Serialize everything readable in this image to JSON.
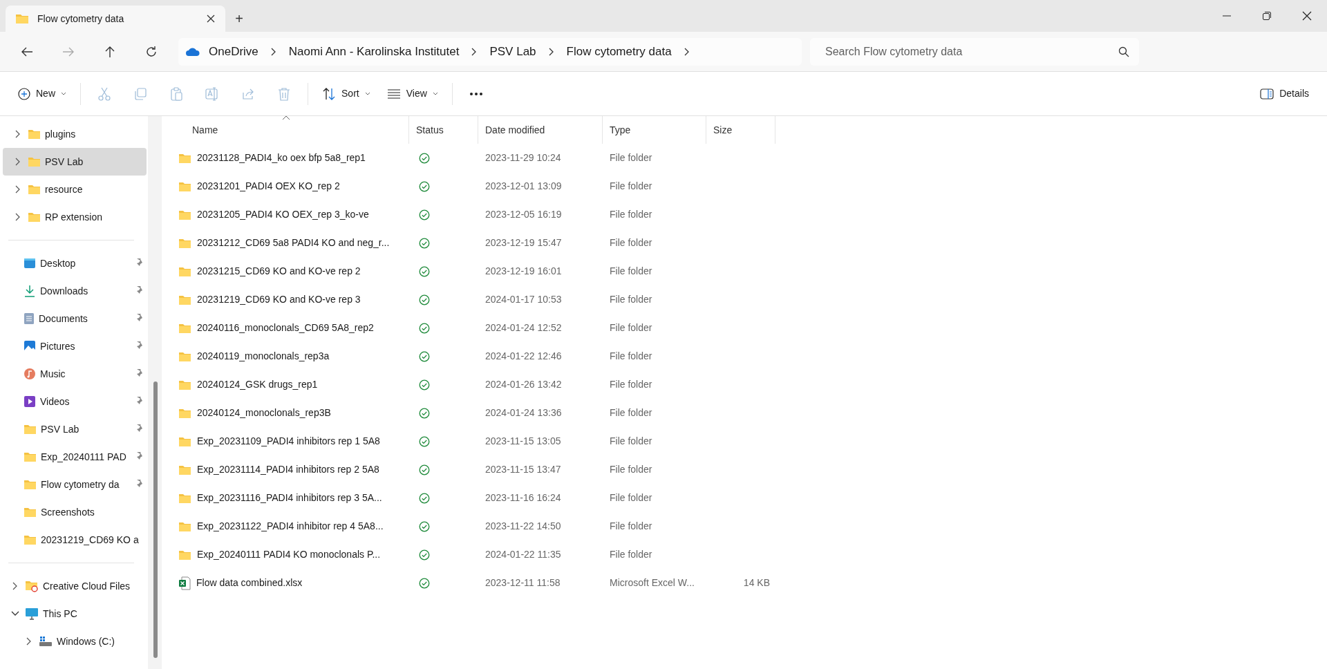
{
  "window": {
    "tab_title": "Flow cytometry data",
    "new_tab": "+"
  },
  "address_bar": {
    "crumbs": [
      "OneDrive",
      "Naomi Ann - Karolinska Institutet",
      "PSV Lab",
      "Flow cytometry data"
    ]
  },
  "search": {
    "placeholder": "Search Flow cytometry data"
  },
  "toolbar": [
    {
      "kind": "new",
      "label": "New",
      "disabled": false
    },
    {
      "kind": "cut",
      "disabled": true
    },
    {
      "kind": "copy",
      "disabled": true
    },
    {
      "kind": "paste",
      "disabled": true
    },
    {
      "kind": "rename",
      "disabled": true
    },
    {
      "kind": "share",
      "disabled": true
    },
    {
      "kind": "delete",
      "disabled": true
    },
    {
      "kind": "sort",
      "label": "Sort",
      "disabled": false
    },
    {
      "kind": "view",
      "label": "View",
      "disabled": false
    },
    {
      "kind": "more",
      "disabled": false
    }
  ],
  "details_button": {
    "label": "Details"
  },
  "sidebar": {
    "tree_top": [
      {
        "label": "plugins",
        "selected": false,
        "expanded": false
      },
      {
        "label": "PSV Lab",
        "selected": true,
        "expanded": false
      },
      {
        "label": "resource",
        "selected": false,
        "expanded": false
      },
      {
        "label": "RP extension",
        "selected": false,
        "expanded": false
      }
    ],
    "quick_access": [
      {
        "kind": "desktop",
        "label": "Desktop",
        "pinned": true
      },
      {
        "kind": "downloads",
        "label": "Downloads",
        "pinned": true
      },
      {
        "kind": "documents",
        "label": "Documents",
        "pinned": true
      },
      {
        "kind": "pictures",
        "label": "Pictures",
        "pinned": true
      },
      {
        "kind": "music",
        "label": "Music",
        "pinned": true
      },
      {
        "kind": "videos",
        "label": "Videos",
        "pinned": true
      },
      {
        "kind": "folder",
        "label": "PSV Lab",
        "pinned": true
      },
      {
        "kind": "folder",
        "label": "Exp_20240111 PAD",
        "pinned": true
      },
      {
        "kind": "folder",
        "label": "Flow cytometry da",
        "pinned": true
      },
      {
        "kind": "folder",
        "label": "Screenshots",
        "pinned": false
      },
      {
        "kind": "folder",
        "label": "20231219_CD69 KO a",
        "pinned": false
      }
    ],
    "tree_bottom": [
      {
        "kind": "cloud",
        "label": "Creative Cloud Files",
        "expanded": false
      },
      {
        "kind": "pc",
        "label": "This PC",
        "expanded": true,
        "children": [
          {
            "kind": "drive",
            "label": "Windows (C:)",
            "expanded": false
          }
        ]
      }
    ]
  },
  "table": {
    "columns": [
      "Name",
      "Status",
      "Date modified",
      "Type",
      "Size"
    ],
    "rows": [
      {
        "kind": "folder",
        "name": "20231128_PADI4_ko oex bfp 5a8_rep1",
        "date": "2023-11-29 10:24",
        "type": "File folder"
      },
      {
        "kind": "folder",
        "name": "20231201_PADI4 OEX KO_rep 2",
        "date": "2023-12-01 13:09",
        "type": "File folder"
      },
      {
        "kind": "folder",
        "name": "20231205_PADI4 KO OEX_rep 3_ko-ve",
        "date": "2023-12-05 16:19",
        "type": "File folder"
      },
      {
        "kind": "folder",
        "name": "20231212_CD69 5a8 PADI4 KO and neg_r...",
        "date": "2023-12-19 15:47",
        "type": "File folder"
      },
      {
        "kind": "folder",
        "name": "20231215_CD69 KO and KO-ve rep 2",
        "date": "2023-12-19 16:01",
        "type": "File folder"
      },
      {
        "kind": "folder",
        "name": "20231219_CD69 KO and KO-ve rep 3",
        "date": "2024-01-17 10:53",
        "type": "File folder"
      },
      {
        "kind": "folder",
        "name": "20240116_monoclonals_CD69 5A8_rep2",
        "date": "2024-01-24 12:52",
        "type": "File folder"
      },
      {
        "kind": "folder",
        "name": "20240119_monoclonals_rep3a",
        "date": "2024-01-22 12:46",
        "type": "File folder"
      },
      {
        "kind": "folder",
        "name": "20240124_GSK drugs_rep1",
        "date": "2024-01-26 13:42",
        "type": "File folder"
      },
      {
        "kind": "folder",
        "name": "20240124_monoclonals_rep3B",
        "date": "2024-01-24 13:36",
        "type": "File folder"
      },
      {
        "kind": "folder",
        "name": "Exp_20231109_PADI4 inhibitors rep 1 5A8",
        "date": "2023-11-15 13:05",
        "type": "File folder"
      },
      {
        "kind": "folder",
        "name": "Exp_20231114_PADI4 inhibitors rep 2 5A8",
        "date": "2023-11-15 13:47",
        "type": "File folder"
      },
      {
        "kind": "folder",
        "name": "Exp_20231116_PADI4 inhibitors rep 3 5A...",
        "date": "2023-11-16 16:24",
        "type": "File folder"
      },
      {
        "kind": "folder",
        "name": "Exp_20231122_PADI4 inhibitor rep 4 5A8...",
        "date": "2023-11-22 14:50",
        "type": "File folder"
      },
      {
        "kind": "folder",
        "name": "Exp_20240111 PADI4 KO monoclonals P...",
        "date": "2024-01-22 11:35",
        "type": "File folder"
      },
      {
        "kind": "excel",
        "name": "Flow data combined.xlsx",
        "date": "2023-12-11 11:58",
        "type": "Microsoft Excel W...",
        "size": "14 KB"
      }
    ]
  }
}
